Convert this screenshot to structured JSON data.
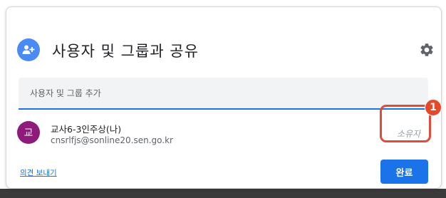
{
  "dialog": {
    "title": "사용자 및 그룹과 공유"
  },
  "share_input": {
    "placeholder": "사용자 및 그룹 추가"
  },
  "user": {
    "avatar_letter": "교",
    "name": "교사6-3인주상(나)",
    "email": "cnsrlfjs@sonline20.sen.go.kr",
    "role": "소유자"
  },
  "annotation": {
    "badge": "1"
  },
  "footer": {
    "feedback_label": "의견 보내기",
    "done_label": "완료"
  },
  "icons": {
    "header": "add-person-icon",
    "settings": "gear-icon"
  },
  "colors": {
    "accent": "#1a73e8",
    "header_avatar": "#4a8af4",
    "user_avatar": "#8e1a7a",
    "highlight": "#e14b3a"
  }
}
